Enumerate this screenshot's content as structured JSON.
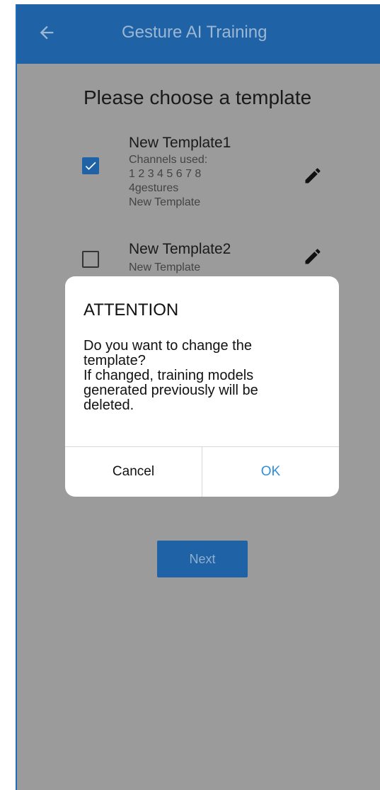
{
  "appbar": {
    "title": "Gesture AI Training",
    "back_icon": "arrow-back-icon"
  },
  "heading": "Please choose a template",
  "templates": [
    {
      "name": "New Template1",
      "checked": true,
      "details": [
        "Channels used:",
        "1 2 3 4 5 6 7 8",
        "4gestures",
        "New Template"
      ],
      "edit_icon": "pencil-icon"
    },
    {
      "name": "New Template2",
      "checked": false,
      "details": [
        "New Template"
      ],
      "edit_icon": "pencil-icon"
    }
  ],
  "dialog": {
    "title": "ATTENTION",
    "message": "Do you want to change the\ntemplate?\nIf changed, training models\ngenerated previously will be\ndeleted.",
    "cancel_label": "Cancel",
    "ok_label": "OK"
  },
  "next_label": "Next",
  "colors": {
    "appbar": "#1f63a6",
    "scrim": "#9b9b9b",
    "accent": "#2f8fd8"
  }
}
